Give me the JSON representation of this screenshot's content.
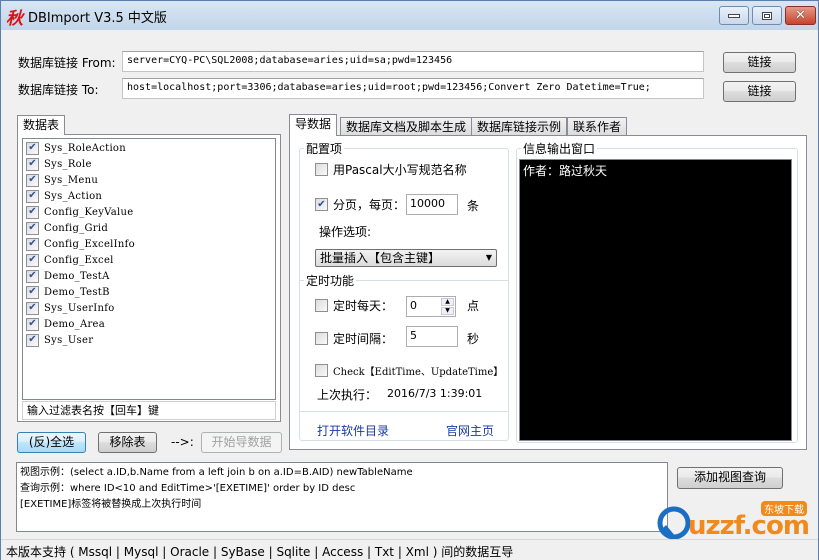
{
  "window": {
    "icon_glyph": "秋",
    "title": "DBImport V3.5 中文版",
    "controls": {
      "minimize": "minimize",
      "maximize": "maximize",
      "close": "✕"
    }
  },
  "connection": {
    "from_label": "数据库链接 From:",
    "from_value": "server=CYQ-PC\\SQL2008;database=aries;uid=sa;pwd=123456",
    "to_label": "数据库链接 To:",
    "to_value": "host=localhost;port=3306;database=aries;uid=root;pwd=123456;Convert Zero Datetime=True;",
    "connect_button": "链接"
  },
  "tables_panel": {
    "tab_label": "数据表",
    "items": [
      {
        "name": "Sys_RoleAction",
        "checked": true
      },
      {
        "name": "Sys_Role",
        "checked": true
      },
      {
        "name": "Sys_Menu",
        "checked": true
      },
      {
        "name": "Sys_Action",
        "checked": true
      },
      {
        "name": "Config_KeyValue",
        "checked": true
      },
      {
        "name": "Config_Grid",
        "checked": true
      },
      {
        "name": "Config_ExcelInfo",
        "checked": true
      },
      {
        "name": "Config_Excel",
        "checked": true
      },
      {
        "name": "Demo_TestA",
        "checked": true
      },
      {
        "name": "Demo_TestB",
        "checked": true
      },
      {
        "name": "Sys_UserInfo",
        "checked": true
      },
      {
        "name": "Demo_Area",
        "checked": true
      },
      {
        "name": "Sys_User",
        "checked": true
      }
    ],
    "filter_value": "输入过滤表名按【回车】键",
    "select_all_button": "(反)全选",
    "remove_button": "移除表",
    "arrow_label": "-->:",
    "start_button": "开始导数据"
  },
  "tabs": [
    {
      "label": "导数据",
      "active": true
    },
    {
      "label": "数据库文档及脚本生成",
      "active": false
    },
    {
      "label": "数据库链接示例",
      "active": false
    },
    {
      "label": "联系作者",
      "active": false
    }
  ],
  "config": {
    "group_title": "配置项",
    "pascal_label": "用Pascal大小写规范名称",
    "pascal_checked": false,
    "paging_label": "分页，每页：",
    "paging_checked": true,
    "page_size": "10000",
    "page_unit": "条",
    "operation_label": "操作选项:",
    "operation_value": "批量插入【包含主键】"
  },
  "timer": {
    "group_title": "定时功能",
    "daily_label": "定时每天：",
    "daily_checked": false,
    "daily_value": "0",
    "daily_unit": "点",
    "interval_label": "定时间隔：",
    "interval_checked": false,
    "interval_value": "5",
    "interval_unit": "秒",
    "check_label": "Check【EditTime、UpdateTime】",
    "check_checked": false,
    "last_run_label": "上次执行：",
    "last_run_value": "2016/7/3 1:39:01"
  },
  "links": {
    "open_dir": "打开软件目录",
    "homepage": "官网主页"
  },
  "output": {
    "group_title": "信息输出窗口",
    "text": "作者：路过秋天"
  },
  "view_query": {
    "lines": [
      "视图示例：(select a.ID,b.Name from a left join b on a.ID=B.AID) newTableName",
      "查询示例：where ID<10 and EditTime>'[EXETIME]' order by ID desc",
      "[EXETIME]标签将被替换成上次执行时间"
    ],
    "add_button": "添加视图查询"
  },
  "status_bar": {
    "text": "本版本支持 ( Mssql | Mysql | Oracle | SyBase | Sqlite | Access | Txt | Xml ) 间的数据互导"
  },
  "watermark": {
    "text": "uzzf.com",
    "badge": "东坡下载",
    "colors": {
      "blue": "#1a6fc4",
      "orange": "#f08a1c"
    }
  }
}
